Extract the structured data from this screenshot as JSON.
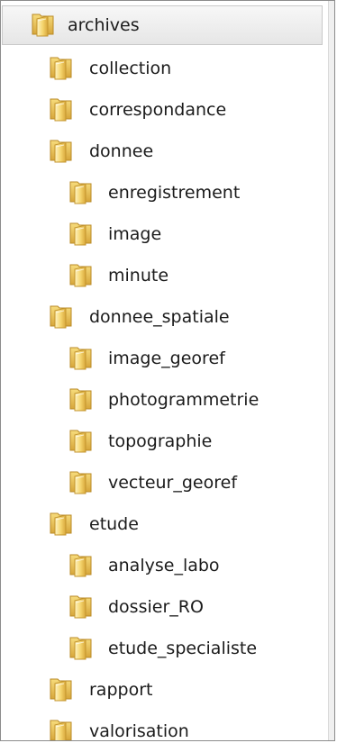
{
  "tree": {
    "root": {
      "label": "archives",
      "icon": "folder-icon",
      "selected": true
    },
    "items": [
      {
        "label": "collection",
        "level": 1,
        "icon": "folder-icon"
      },
      {
        "label": "correspondance",
        "level": 1,
        "icon": "folder-icon"
      },
      {
        "label": "donnee",
        "level": 1,
        "icon": "folder-icon"
      },
      {
        "label": "enregistrement",
        "level": 2,
        "icon": "folder-icon"
      },
      {
        "label": "image",
        "level": 2,
        "icon": "folder-icon"
      },
      {
        "label": "minute",
        "level": 2,
        "icon": "folder-icon"
      },
      {
        "label": "donnee_spatiale",
        "level": 1,
        "icon": "folder-icon"
      },
      {
        "label": "image_georef",
        "level": 2,
        "icon": "folder-icon"
      },
      {
        "label": "photogrammetrie",
        "level": 2,
        "icon": "folder-icon"
      },
      {
        "label": "topographie",
        "level": 2,
        "icon": "folder-icon"
      },
      {
        "label": "vecteur_georef",
        "level": 2,
        "icon": "folder-icon"
      },
      {
        "label": "etude",
        "level": 1,
        "icon": "folder-icon"
      },
      {
        "label": "analyse_labo",
        "level": 2,
        "icon": "folder-icon"
      },
      {
        "label": "dossier_RO",
        "level": 2,
        "icon": "folder-icon"
      },
      {
        "label": "etude_specialiste",
        "level": 2,
        "icon": "folder-icon"
      },
      {
        "label": "rapport",
        "level": 1,
        "icon": "folder-icon"
      },
      {
        "label": "valorisation",
        "level": 1,
        "icon": "folder-icon"
      }
    ]
  },
  "colors": {
    "folder_light": "#fbe7a0",
    "folder_mid": "#efc75a",
    "folder_dark": "#c8962a",
    "selection_bg": "#e8e8e8",
    "text": "#1b1b1b"
  }
}
